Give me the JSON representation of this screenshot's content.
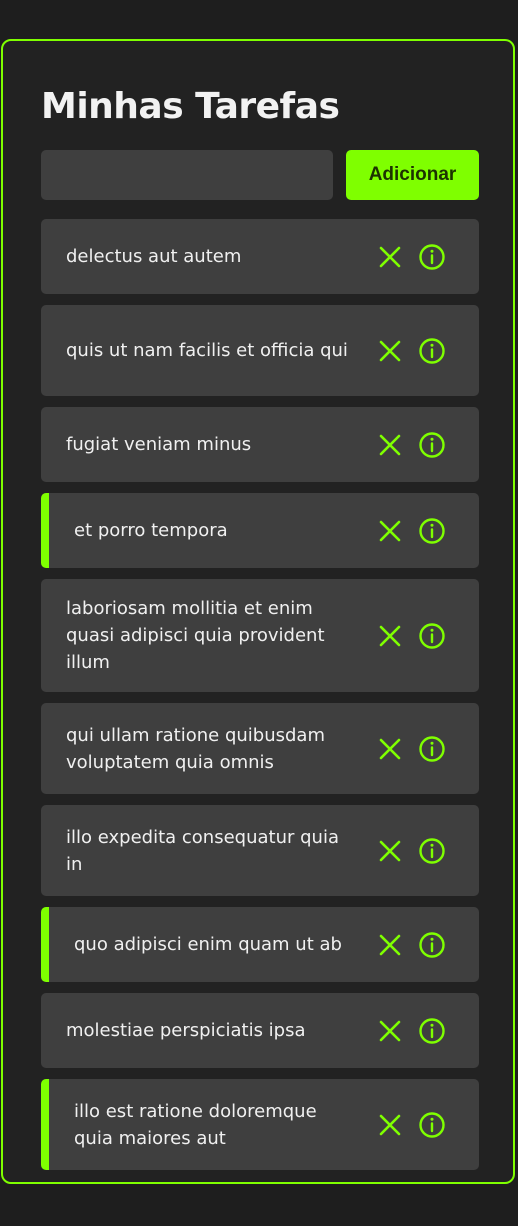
{
  "app": {
    "title": "Minhas Tarefas",
    "accent_color": "#7fff00"
  },
  "form": {
    "input_value": "",
    "input_placeholder": "",
    "add_label": "Adicionar"
  },
  "tasks": [
    {
      "title": "delectus aut autem",
      "completed": false,
      "icons": [
        "close-icon",
        "info-icon"
      ]
    },
    {
      "title": "quis ut nam facilis et officia qui",
      "completed": false,
      "icons": [
        "close-icon",
        "info-icon"
      ]
    },
    {
      "title": "fugiat veniam minus",
      "completed": false,
      "icons": [
        "close-icon",
        "info-icon"
      ]
    },
    {
      "title": "et porro tempora",
      "completed": true,
      "icons": [
        "close-icon",
        "info-icon"
      ]
    },
    {
      "title": "laboriosam mollitia et enim quasi adipisci quia provident illum",
      "completed": false,
      "icons": [
        "close-icon",
        "info-icon"
      ]
    },
    {
      "title": "qui ullam ratione quibusdam voluptatem quia omnis",
      "completed": false,
      "icons": [
        "close-icon",
        "info-icon"
      ]
    },
    {
      "title": "illo expedita consequatur quia in",
      "completed": false,
      "icons": [
        "close-icon",
        "info-icon"
      ]
    },
    {
      "title": "quo adipisci enim quam ut ab",
      "completed": true,
      "icons": [
        "close-icon",
        "info-icon"
      ]
    },
    {
      "title": "molestiae perspiciatis ipsa",
      "completed": false,
      "icons": [
        "close-icon",
        "info-icon"
      ]
    },
    {
      "title": "illo est ratione doloremque quia maiores aut",
      "completed": true,
      "icons": [
        "close-icon",
        "info-icon"
      ]
    }
  ]
}
